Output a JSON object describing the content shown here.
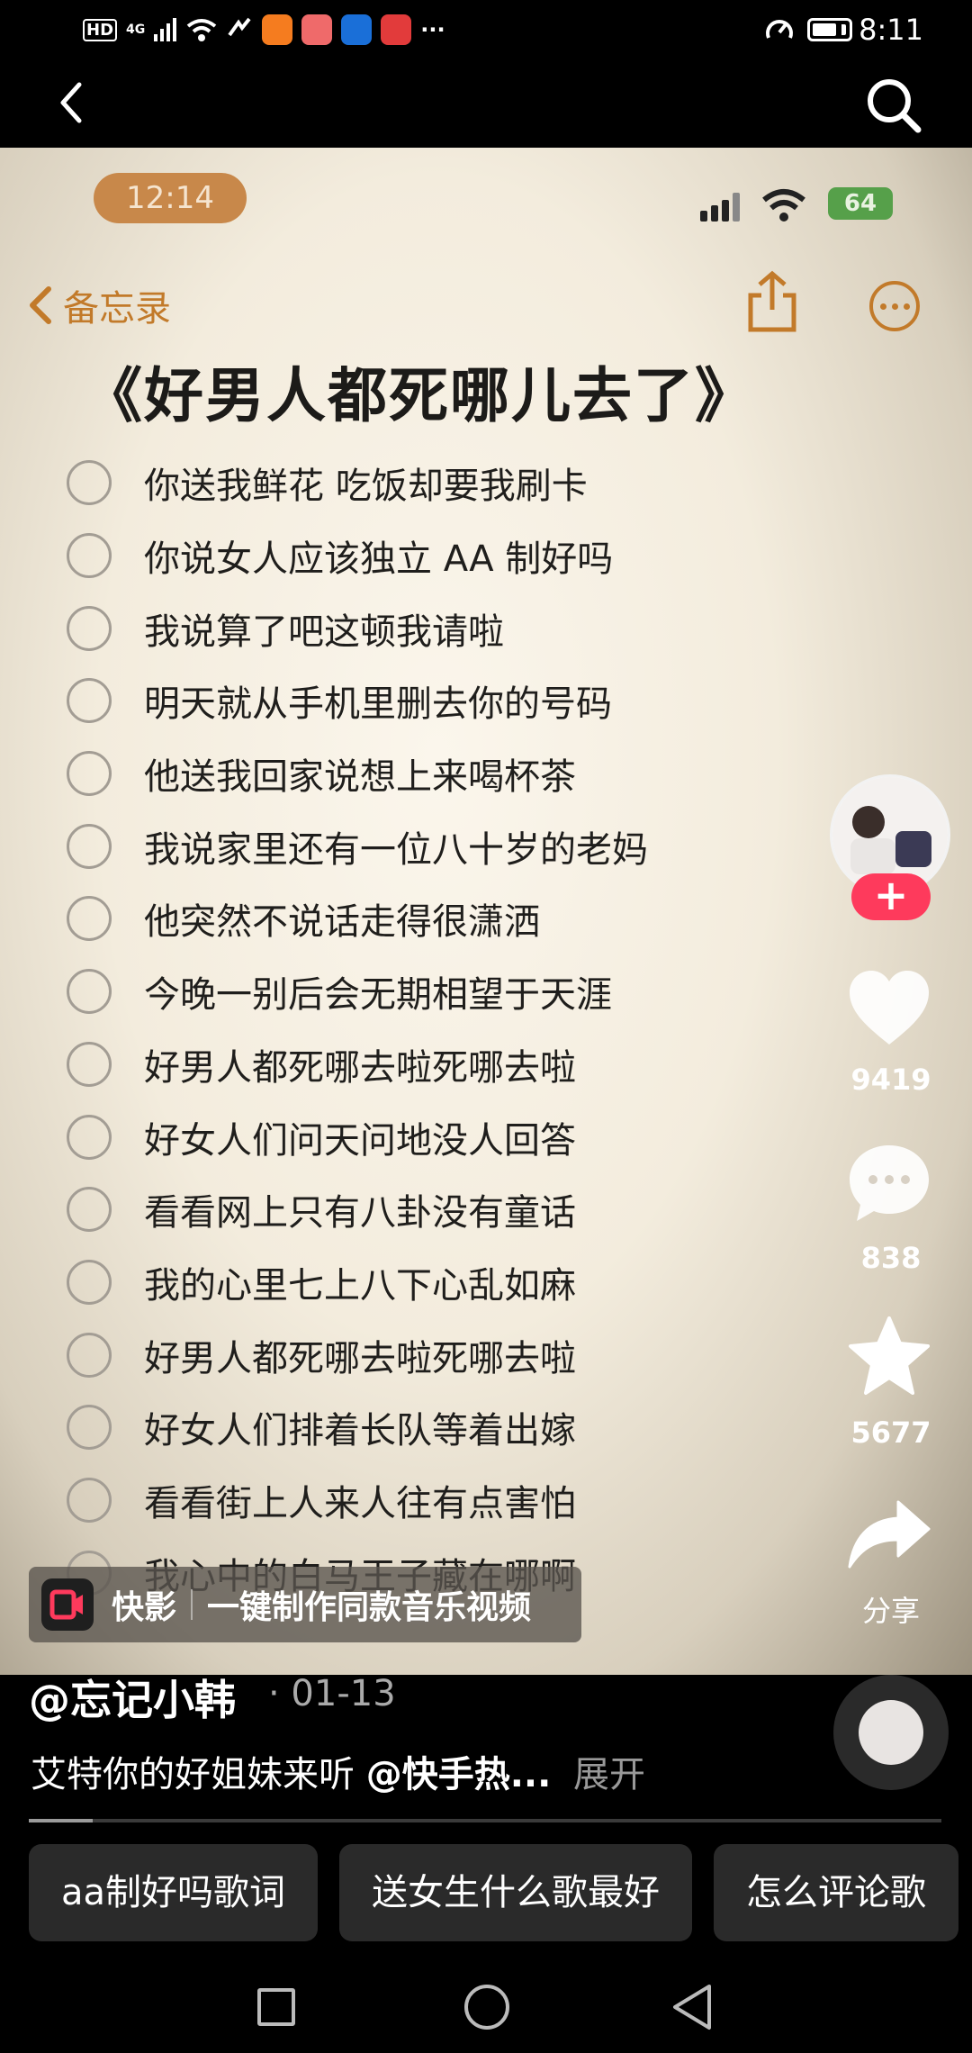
{
  "status_bar": {
    "left_label": "HD",
    "network": "4G",
    "more": "···",
    "time": "8:11",
    "app_icon_colors": [
      "#f57c1f",
      "#ef6a6a",
      "#1a6fd8",
      "#e23b3b"
    ]
  },
  "nav": {
    "back_icon": "chevron-left-icon",
    "search_icon": "search-icon"
  },
  "video": {
    "phone_time": "12:14",
    "phone_battery": "64",
    "memo_back_label": "备忘录",
    "title": "《好男人都死哪儿去了》",
    "items": [
      "你送我鲜花 吃饭却要我刷卡",
      "你说女人应该独立 AA 制好吗",
      "我说算了吧这顿我请啦",
      "明天就从手机里删去你的号码",
      "他送我回家说想上来喝杯茶",
      "我说家里还有一位八十岁的老妈",
      "他突然不说话走得很潇洒",
      "今晚一别后会无期相望于天涯",
      "好男人都死哪去啦死哪去啦",
      "好女人们问天问地没人回答",
      "看看网上只有八卦没有童话",
      "我的心里七上八下心乱如麻",
      "好男人都死哪去啦死哪去啦",
      "好女人们排着长队等着出嫁",
      "看看街上人来人往有点害怕",
      "我心中的白马王子藏在哪啊"
    ]
  },
  "rail": {
    "like_count": "9419",
    "comment_count": "838",
    "favorite_count": "5677",
    "share_label": "分享",
    "accent_color": "#fe3a5c"
  },
  "promo": {
    "app_name": "快影",
    "text": "一键制作同款音乐视频"
  },
  "post": {
    "author": "@忘记小韩",
    "date": "· 01-13",
    "caption_text": "艾特你的好姐妹来听",
    "caption_mention": "@快手热...",
    "caption_more": "展开",
    "progress_percent": 7
  },
  "chips": [
    "aa制好吗歌词",
    "送女生什么歌最好",
    "怎么评论歌"
  ]
}
